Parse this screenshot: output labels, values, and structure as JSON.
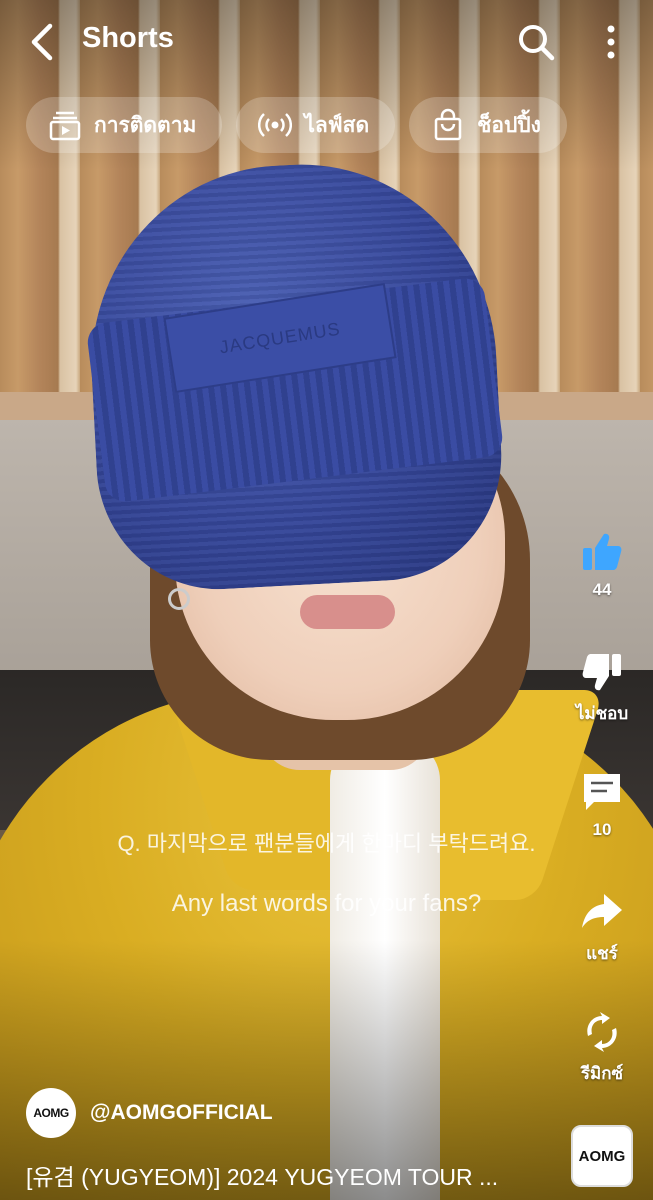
{
  "header": {
    "title": "Shorts",
    "back_icon": "chevron-left-icon",
    "search_icon": "search-icon",
    "more_icon": "more-vertical-icon"
  },
  "chips": [
    {
      "label": "การติดตาม",
      "icon": "subscriptions-icon"
    },
    {
      "label": "ไลฟ์สด",
      "icon": "live-broadcast-icon"
    },
    {
      "label": "ช็อปปิ้ง",
      "icon": "shopping-bag-icon"
    }
  ],
  "actions": {
    "like": {
      "label": "44",
      "icon": "thumbs-up-icon",
      "color": "#3ea6ff"
    },
    "dislike": {
      "label": "ไม่ชอบ",
      "icon": "thumbs-down-icon"
    },
    "comments": {
      "label": "10",
      "icon": "comment-icon"
    },
    "share": {
      "label": "แชร์",
      "icon": "share-icon"
    },
    "remix": {
      "label": "รีมิกซ์",
      "icon": "remix-icon"
    }
  },
  "video": {
    "caption_korean": "Q. 마지막으로 팬분들에게 한마디 부탁드려요.",
    "caption_english": "Any last words for your fans?",
    "beanie_text": "JACQUEMUS"
  },
  "channel": {
    "avatar_text": "AOMG",
    "handle": "@AOMGOFFICIAL",
    "title": "[유겸 (YUGYEOM)] 2024 YUGYEOM TOUR ...",
    "sound_text": "AOMG"
  }
}
